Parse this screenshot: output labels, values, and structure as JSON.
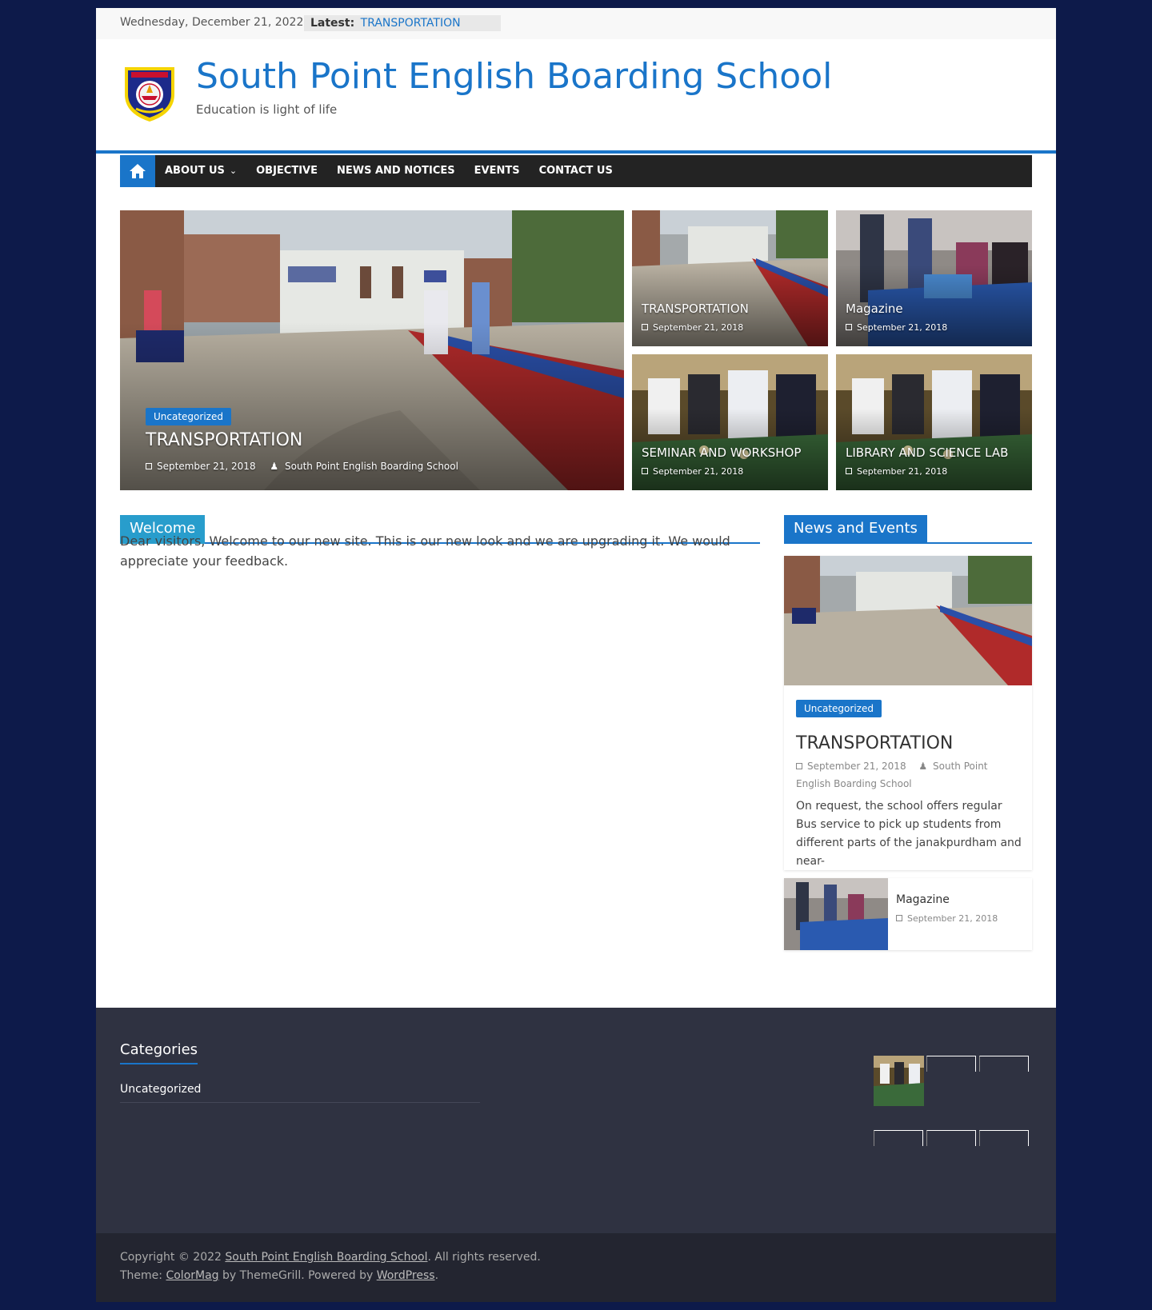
{
  "topbar": {
    "date": "Wednesday, December 21, 2022",
    "latest_label": "Latest:",
    "latest_link": "TRANSPORTATION"
  },
  "header": {
    "title": "South Point English Boarding School",
    "tagline": "Education is light of life"
  },
  "nav": {
    "items": [
      "ABOUT US",
      "OBJECTIVE",
      "NEWS AND NOTICES",
      "EVENTS",
      "CONTACT US"
    ]
  },
  "slider": {
    "main": {
      "category": "Uncategorized",
      "title": "TRANSPORTATION",
      "date": "September 21, 2018",
      "author": "South Point English Boarding School"
    },
    "tiles": [
      {
        "title": "TRANSPORTATION",
        "date": "September 21, 2018"
      },
      {
        "title": "Magazine",
        "date": "September 21, 2018"
      },
      {
        "title": "SEMINAR AND WORKSHOP",
        "date": "September 21, 2018"
      },
      {
        "title": "LIBRARY AND SCIENCE LAB",
        "date": "September 21, 2018"
      }
    ]
  },
  "welcome": {
    "heading": "Welcome",
    "text": "Dear visitors, Welcome to our new site. This is our new look and we are upgrading it. We would appreciate your feedback."
  },
  "news": {
    "heading": "News and Events",
    "featured": {
      "category": "Uncategorized",
      "title": "TRANSPORTATION",
      "date": "September 21, 2018",
      "author": "South Point English Boarding School",
      "excerpt": "On request, the school offers regular Bus service to pick up students from different parts of the janakpurdham and near-"
    },
    "small": {
      "title": "Magazine",
      "date": "September 21, 2018"
    }
  },
  "footer": {
    "categories_heading": "Categories",
    "categories": [
      "Uncategorized"
    ],
    "copyright_prefix": "Copyright © 2022 ",
    "site_link": "South Point English Boarding School",
    "copyright_suffix": ". All rights reserved.",
    "theme_prefix": "Theme: ",
    "theme_link": "ColorMag",
    "theme_mid": " by ThemeGrill. Powered by ",
    "wp_link": "WordPress",
    "theme_suffix": "."
  },
  "colors": {
    "background": "#0d1a4a",
    "accent": "#1a75c9",
    "nav": "#232323",
    "footer": "#2f3241",
    "copyright": "#232530"
  },
  "icons": [
    "home-icon",
    "calendar-icon",
    "user-icon",
    "chevron-down-icon",
    "school-crest-logo"
  ]
}
